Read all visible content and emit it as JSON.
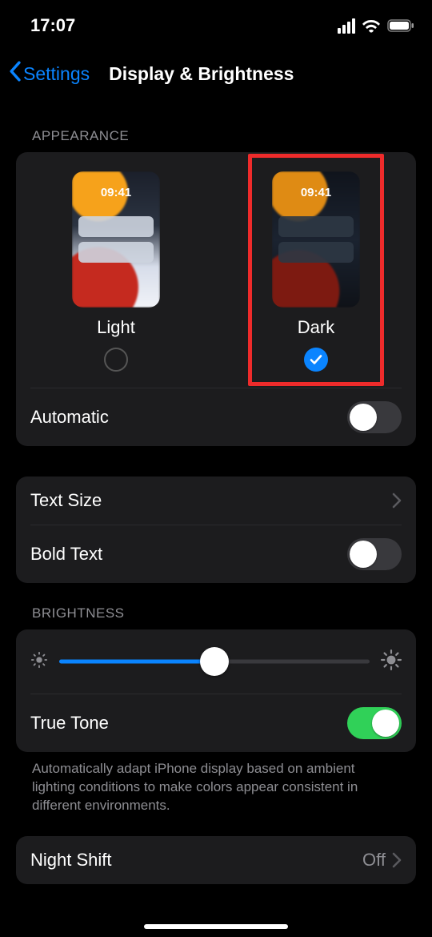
{
  "status": {
    "time": "17:07"
  },
  "nav": {
    "back_label": "Settings",
    "title": "Display & Brightness"
  },
  "appearance": {
    "header": "APPEARANCE",
    "preview_time": "09:41",
    "light_label": "Light",
    "dark_label": "Dark",
    "selected": "dark",
    "automatic_label": "Automatic",
    "automatic_on": false
  },
  "text": {
    "text_size_label": "Text Size",
    "bold_text_label": "Bold Text",
    "bold_on": false
  },
  "brightness": {
    "header": "BRIGHTNESS",
    "value_percent": 50,
    "true_tone_label": "True Tone",
    "true_tone_on": true,
    "true_tone_desc": "Automatically adapt iPhone display based on ambient lighting conditions to make colors appear consistent in different environments."
  },
  "night_shift": {
    "label": "Night Shift",
    "value": "Off"
  }
}
